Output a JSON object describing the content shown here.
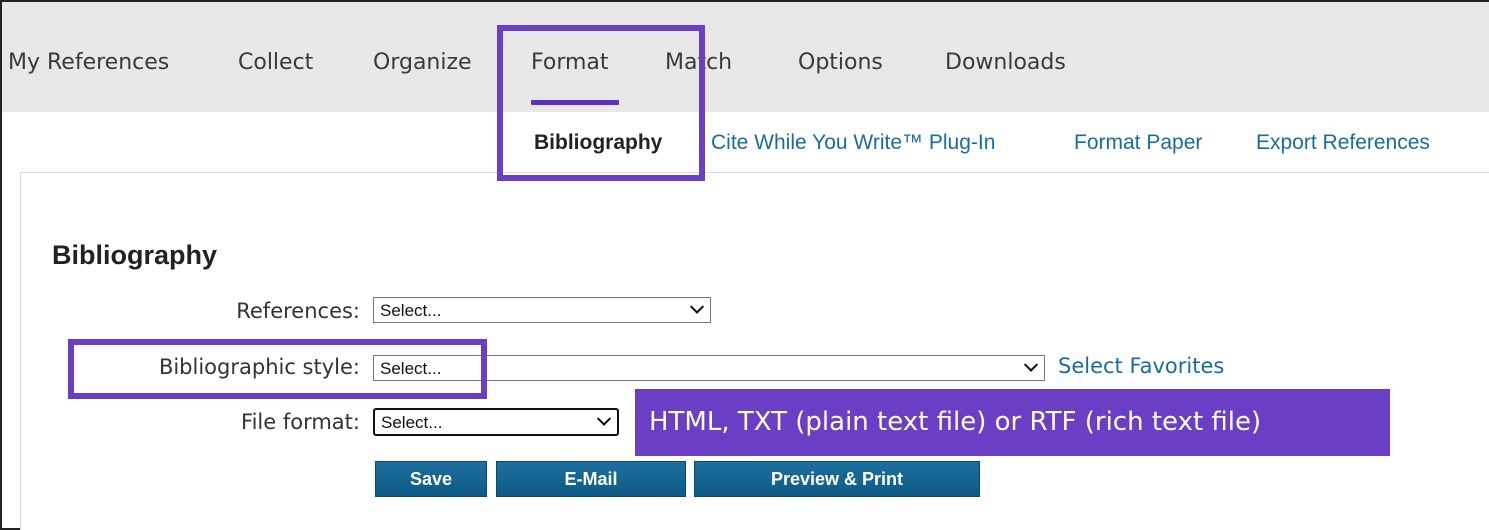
{
  "nav": {
    "tabs": [
      "My References",
      "Collect",
      "Organize",
      "Format",
      "Match",
      "Options",
      "Downloads"
    ],
    "active_tab": "Format"
  },
  "subnav": {
    "items": [
      "Bibliography",
      "Cite While You Write™ Plug-In",
      "Format Paper",
      "Export References"
    ],
    "active_item": "Bibliography"
  },
  "form": {
    "heading": "Bibliography",
    "references_label": "References:",
    "references_value": "Select...",
    "style_label": "Bibliographic style:",
    "style_value": "Select...",
    "select_favorites": "Select Favorites",
    "file_format_label": "File format:",
    "file_format_value": "Select..."
  },
  "buttons": {
    "save": "Save",
    "email": "E-Mail",
    "preview_print": "Preview & Print"
  },
  "callout": {
    "text": "HTML, TXT (plain text file) or RTF (rich text file)"
  },
  "colors": {
    "highlight": "#6a3fc6",
    "link": "#1a6c9c",
    "button": "#0e5a85",
    "nav_bg": "#e8e8e8"
  }
}
